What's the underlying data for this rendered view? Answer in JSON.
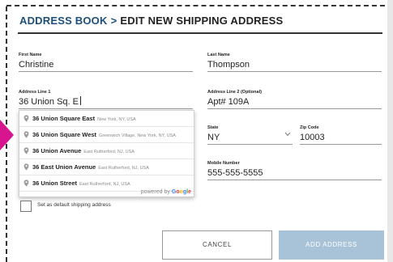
{
  "header": {
    "breadcrumb_link": "ADDRESS BOOK",
    "separator": ">",
    "current": "EDIT NEW SHIPPING ADDRESS"
  },
  "form": {
    "first_name": {
      "label": "First Name",
      "value": "Christine"
    },
    "last_name": {
      "label": "Last Name",
      "value": "Thompson"
    },
    "address1": {
      "label": "Address Line 1",
      "value": "36 Union Sq. E"
    },
    "address2": {
      "label": "Address Line 2 (Optional)",
      "value": "Apt# 109A"
    },
    "state": {
      "label": "State",
      "value": "NY",
      "icon": "chevron-down-icon"
    },
    "zip": {
      "label": "Zip Code",
      "value": "10003"
    },
    "mobile": {
      "label": "Mobile Number",
      "value": "555-555-5555"
    }
  },
  "autocomplete": {
    "suggestions": [
      {
        "main": "36 Union Square East",
        "secondary": "New York, NY, USA"
      },
      {
        "main": "36 Union Square West",
        "secondary": "Greenwich Village, New York, NY, USA"
      },
      {
        "main": "36 Union Avenue",
        "secondary": "East Rutherford, NJ, USA"
      },
      {
        "main": "36 East Union Avenue",
        "secondary": "East Rutherford, NJ, USA"
      },
      {
        "main": "36 Union Street",
        "secondary": "East Rutherford, NJ, USA"
      }
    ],
    "powered_by_prefix": "powered by",
    "powered_by_brand": "Google",
    "brand_colors": [
      "#4285F4",
      "#EA4335",
      "#FBBC05",
      "#4285F4",
      "#34A853",
      "#EA4335"
    ]
  },
  "default_checkbox": {
    "label": "Set as default shipping address",
    "checked": false
  },
  "buttons": {
    "cancel": "CANCEL",
    "add": "ADD ADDRESS"
  },
  "colors": {
    "accent": "#1d4f7a",
    "pointer": "#d6158f",
    "add_button": "#a8c3d8"
  }
}
